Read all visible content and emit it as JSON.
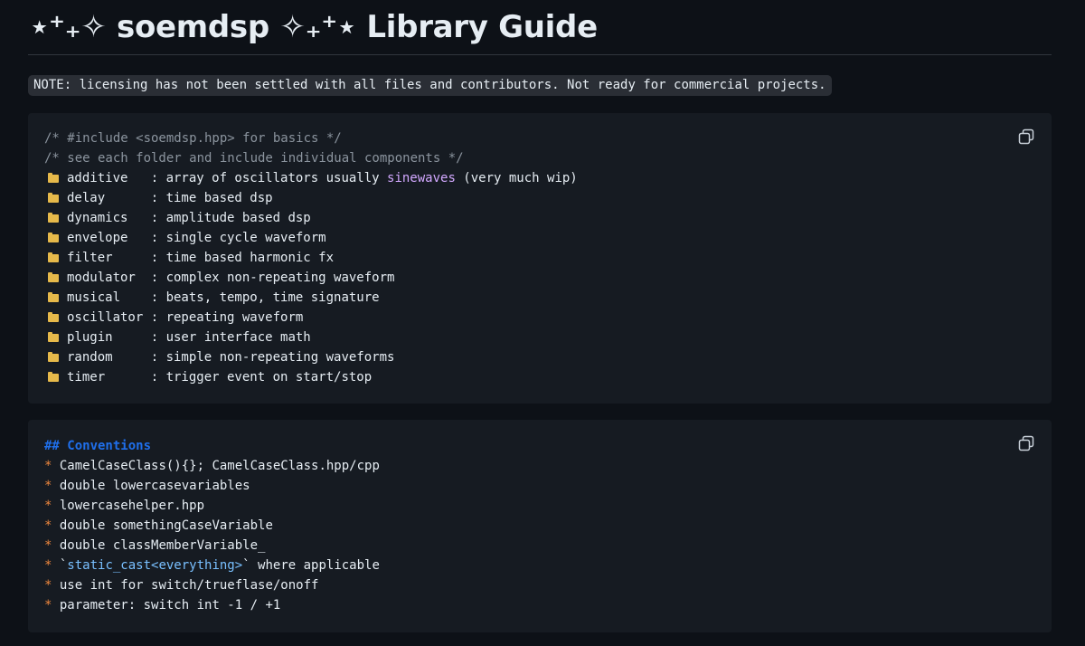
{
  "header": {
    "title": "⋆⁺₊✧ soemdsp ✧₊⁺⋆ Library Guide"
  },
  "note": {
    "text": "NOTE: licensing has not been settled with all files and contributors. Not ready for commercial projects."
  },
  "block1": {
    "comments": [
      "/* #include <soemdsp.hpp> for basics */",
      "/* see each folder and include individual components */"
    ],
    "folders": [
      {
        "name": "additive   ",
        "sep": ": ",
        "desc": "array of oscillators usually ",
        "highlight": "sinewaves",
        "desc_after": " (very much wip)"
      },
      {
        "name": "delay      ",
        "sep": ": ",
        "desc": "time based dsp"
      },
      {
        "name": "dynamics   ",
        "sep": ": ",
        "desc": "amplitude based dsp"
      },
      {
        "name": "envelope   ",
        "sep": ": ",
        "desc": "single cycle waveform"
      },
      {
        "name": "filter     ",
        "sep": ": ",
        "desc": "time based harmonic fx"
      },
      {
        "name": "modulator  ",
        "sep": ": ",
        "desc": "complex non-repeating waveform"
      },
      {
        "name": "musical    ",
        "sep": ": ",
        "desc": "beats, tempo, time signature"
      },
      {
        "name": "oscillator ",
        "sep": ": ",
        "desc": "repeating waveform"
      },
      {
        "name": "plugin     ",
        "sep": ": ",
        "desc": "user interface math"
      },
      {
        "name": "random     ",
        "sep": ": ",
        "desc": "simple non-repeating waveforms"
      },
      {
        "name": "timer      ",
        "sep": ": ",
        "desc": "trigger event on start/stop"
      }
    ]
  },
  "block2": {
    "heading": "## Conventions",
    "bullet": "*",
    "items": [
      {
        "text": " CamelCaseClass(){}; CamelCaseClass.hpp/cpp"
      },
      {
        "text": " double lowercasevariables"
      },
      {
        "text": " lowercasehelper.hpp"
      },
      {
        "text": " double somethingCaseVariable"
      },
      {
        "text": " double classMemberVariable_"
      },
      {
        "pre": " `",
        "link": "static_cast<everything>",
        "text": "` where applicable"
      },
      {
        "text": " use int for switch/trueflase/onoff"
      },
      {
        "text": " parameter: switch int -1 / +1"
      }
    ]
  },
  "icons": {
    "copy": "copy-icon",
    "folder": "folder-icon"
  },
  "colors": {
    "background": "#0d1117",
    "code_background": "#161b22",
    "comment": "#8b949e",
    "keyword": "#d2a8ff",
    "heading": "#1f6feb",
    "bullet": "#f0883e",
    "link": "#79c0ff"
  }
}
